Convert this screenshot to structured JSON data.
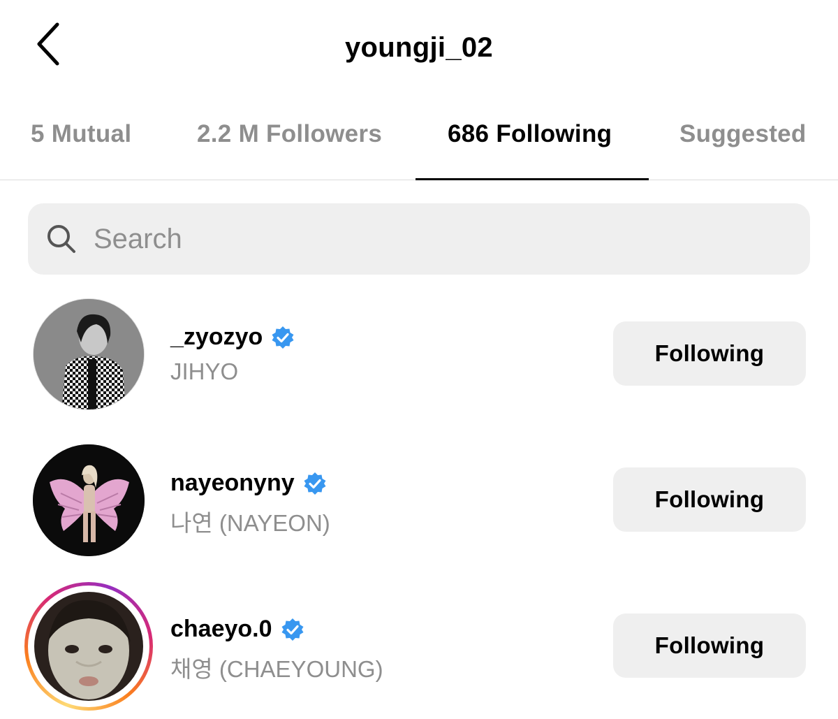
{
  "header": {
    "title": "youngji_02",
    "back_icon": "chevron-left-icon"
  },
  "tabs": [
    {
      "label": "5 Mutual",
      "active": false
    },
    {
      "label": "2.2 M Followers",
      "active": false
    },
    {
      "label": "686 Following",
      "active": true
    },
    {
      "label": "Suggested",
      "active": false
    }
  ],
  "search": {
    "placeholder": "Search",
    "value": "",
    "icon": "search-icon"
  },
  "accounts": [
    {
      "username": "_zyozyo",
      "full_name": "JIHYO",
      "verified": true,
      "button_label": "Following",
      "story_ring": false
    },
    {
      "username": "nayeonyny",
      "full_name": "나연 (NAYEON)",
      "verified": true,
      "button_label": "Following",
      "story_ring": false
    },
    {
      "username": "chaeyo.0",
      "full_name": "채영 (CHAEYOUNG)",
      "verified": true,
      "button_label": "Following",
      "story_ring": true
    }
  ],
  "colors": {
    "verified_badge": "#3897f0",
    "secondary_text": "#8e8e8e",
    "button_bg": "#efefef",
    "story_ring": [
      "#feda75",
      "#fa7e1e",
      "#d62976",
      "#962fbf"
    ]
  }
}
